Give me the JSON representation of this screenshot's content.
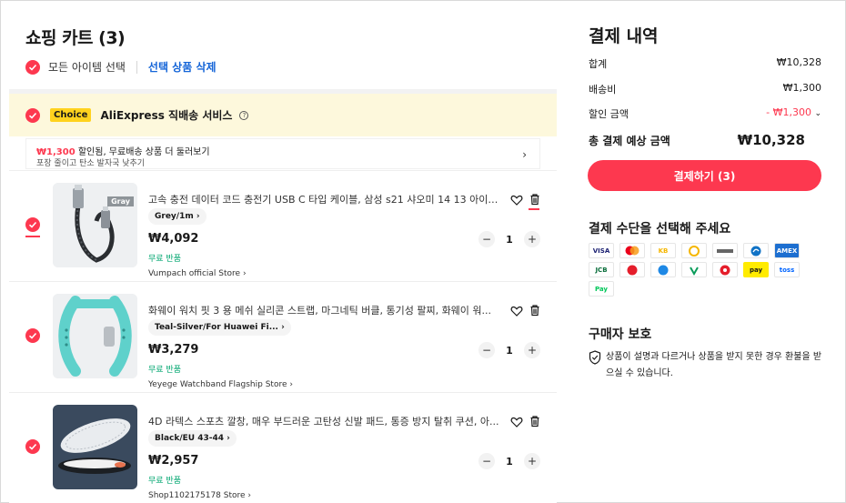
{
  "cart": {
    "title": "쇼핑 카트 (3)",
    "select_all_label": "모든 아이템 선택",
    "delete_selected_label": "선택 상품 삭제"
  },
  "choice": {
    "badge": "Choice",
    "label": "AliExpress 직배송 서비스"
  },
  "promo": {
    "amount": "₩1,300",
    "line1_rest": " 할인됨, 무료배송 상품 더 둘러보기",
    "line2": "포장 줄이고 탄소 발자국 낮추기"
  },
  "items": [
    {
      "title": "고속 충전 데이터 코드 충전기 USB C 타입 케이블, 삼성 s21 샤오미 14 13 아이폰...",
      "variant": "Grey/1m",
      "price": "₩4,092",
      "free_return": "무료 반품",
      "store": "Vumpach official Store",
      "qty": "1",
      "image_tag": "Gray"
    },
    {
      "title": "화웨이 워치 핏 3 용 메쉬 실리콘 스트랩, 마그네틱 버클, 통기성 팔찌, 화웨이 워...",
      "variant": "Teal-Silver/For Huawei Fi...",
      "price": "₩3,279",
      "free_return": "무료 반품",
      "store": "Yeyege Watchband Flagship Store",
      "qty": "1"
    },
    {
      "title": "4D 라텍스 스포츠 깔창, 매우 부드러운 고탄성 신발 패드, 통증 방지 탈취 쿠션, 아...",
      "variant": "Black/EU 43-44",
      "price": "₩2,957",
      "free_return": "무료 반품",
      "store": "Shop1102175178 Store",
      "qty": "1"
    }
  ],
  "summary": {
    "title": "결제 내역",
    "subtotal_label": "합계",
    "subtotal_value": "₩10,328",
    "shipping_label": "배송비",
    "shipping_value": "₩1,300",
    "discount_label": "할인 금액",
    "discount_value": "- ₩1,300",
    "total_label": "총 결제 예상 금액",
    "total_value": "₩10,328",
    "checkout_label": "결제하기 (3)"
  },
  "payment_methods": {
    "title": "결제 수단을 선택해 주세요",
    "logos": [
      "VISA",
      "",
      "KB",
      "",
      "",
      "",
      "AMEX",
      "JCB",
      "",
      "",
      "",
      "",
      "pay",
      "toss",
      "Pay"
    ]
  },
  "buyer_protection": {
    "title": "구매자 보호",
    "text": "상품이 설명과 다르거나 상품을 받지 못한 경우 환불을 받으실 수 있습니다."
  },
  "colors": {
    "accent": "#fd384f",
    "link": "#1565d8",
    "free_return": "#00a66f",
    "choice_bg": "#fdf8dc",
    "choice_badge": "#ffd21e"
  }
}
